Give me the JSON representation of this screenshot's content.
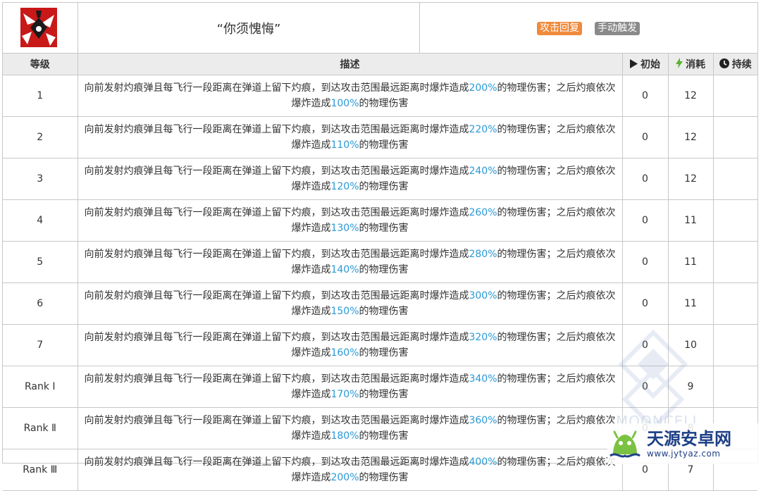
{
  "skill": {
    "name": "“你须愧悔”",
    "tags": [
      "攻击回复",
      "手动触发"
    ]
  },
  "table": {
    "headers": {
      "level": "等级",
      "description": "描述",
      "initial": "初始",
      "cost": "消耗",
      "duration": "持续"
    },
    "rows": [
      {
        "level": "1",
        "desc_a": "向前发射灼痕弹且每飞行一段距离在弹道上留下灼痕，到达攻击范围最远距离时爆炸造成",
        "pct1": "200%",
        "desc_b": "的物理伤害；之后灼痕依次爆炸造成",
        "pct2": "100%",
        "desc_c": "的物理伤害",
        "initial": "0",
        "cost": "12",
        "duration": ""
      },
      {
        "level": "2",
        "desc_a": "向前发射灼痕弹且每飞行一段距离在弹道上留下灼痕，到达攻击范围最远距离时爆炸造成",
        "pct1": "220%",
        "desc_b": "的物理伤害；之后灼痕依次爆炸造成",
        "pct2": "110%",
        "desc_c": "的物理伤害",
        "initial": "0",
        "cost": "12",
        "duration": ""
      },
      {
        "level": "3",
        "desc_a": "向前发射灼痕弹且每飞行一段距离在弹道上留下灼痕，到达攻击范围最远距离时爆炸造成",
        "pct1": "240%",
        "desc_b": "的物理伤害；之后灼痕依次爆炸造成",
        "pct2": "120%",
        "desc_c": "的物理伤害",
        "initial": "0",
        "cost": "12",
        "duration": ""
      },
      {
        "level": "4",
        "desc_a": "向前发射灼痕弹且每飞行一段距离在弹道上留下灼痕，到达攻击范围最远距离时爆炸造成",
        "pct1": "260%",
        "desc_b": "的物理伤害；之后灼痕依次爆炸造成",
        "pct2": "130%",
        "desc_c": "的物理伤害",
        "initial": "0",
        "cost": "11",
        "duration": ""
      },
      {
        "level": "5",
        "desc_a": "向前发射灼痕弹且每飞行一段距离在弹道上留下灼痕，到达攻击范围最远距离时爆炸造成",
        "pct1": "280%",
        "desc_b": "的物理伤害；之后灼痕依次爆炸造成",
        "pct2": "140%",
        "desc_c": "的物理伤害",
        "initial": "0",
        "cost": "11",
        "duration": ""
      },
      {
        "level": "6",
        "desc_a": "向前发射灼痕弹且每飞行一段距离在弹道上留下灼痕，到达攻击范围最远距离时爆炸造成",
        "pct1": "300%",
        "desc_b": "的物理伤害；之后灼痕依次爆炸造成",
        "pct2": "150%",
        "desc_c": "的物理伤害",
        "initial": "0",
        "cost": "11",
        "duration": ""
      },
      {
        "level": "7",
        "desc_a": "向前发射灼痕弹且每飞行一段距离在弹道上留下灼痕，到达攻击范围最远距离时爆炸造成",
        "pct1": "320%",
        "desc_b": "的物理伤害；之后灼痕依次爆炸造成",
        "pct2": "160%",
        "desc_c": "的物理伤害",
        "initial": "0",
        "cost": "10",
        "duration": ""
      },
      {
        "level": "Rank Ⅰ",
        "desc_a": "向前发射灼痕弹且每飞行一段距离在弹道上留下灼痕，到达攻击范围最远距离时爆炸造成",
        "pct1": "340%",
        "desc_b": "的物理伤害；之后灼痕依次爆炸造成",
        "pct2": "170%",
        "desc_c": "的物理伤害",
        "initial": "0",
        "cost": "9",
        "duration": ""
      },
      {
        "level": "Rank Ⅱ",
        "desc_a": "向前发射灼痕弹且每飞行一段距离在弹道上留下灼痕，到达攻击范围最远距离时爆炸造成",
        "pct1": "360%",
        "desc_b": "的物理伤害；之后灼痕依次爆炸造成",
        "pct2": "180%",
        "desc_c": "的物理伤害",
        "initial": "0",
        "cost": "8",
        "duration": ""
      },
      {
        "level": "Rank Ⅲ",
        "desc_a": "向前发射灼痕弹且每飞行一段距离在弹道上留下灼痕，到达攻击范围最远距离时爆炸造成",
        "pct1": "400%",
        "desc_b": "的物理伤害；之后灼痕依次爆炸造成",
        "pct2": "200%",
        "desc_c": "的物理伤害",
        "initial": "0",
        "cost": "7",
        "duration": ""
      }
    ]
  },
  "watermark": "MOONCELL",
  "brand": {
    "name": "天源安卓网",
    "url": "www.jytyaz.com"
  },
  "colors": {
    "highlight": "#2a9ad6",
    "tag_recover": "#f08a3c",
    "tag_trigger": "#8a8a8a",
    "header_bg": "#ececec",
    "cost_icon": "#58b430",
    "brand": "#1d3f86"
  },
  "icons": {
    "initial": "play-icon",
    "cost": "lightning-icon",
    "duration": "clock-icon"
  }
}
